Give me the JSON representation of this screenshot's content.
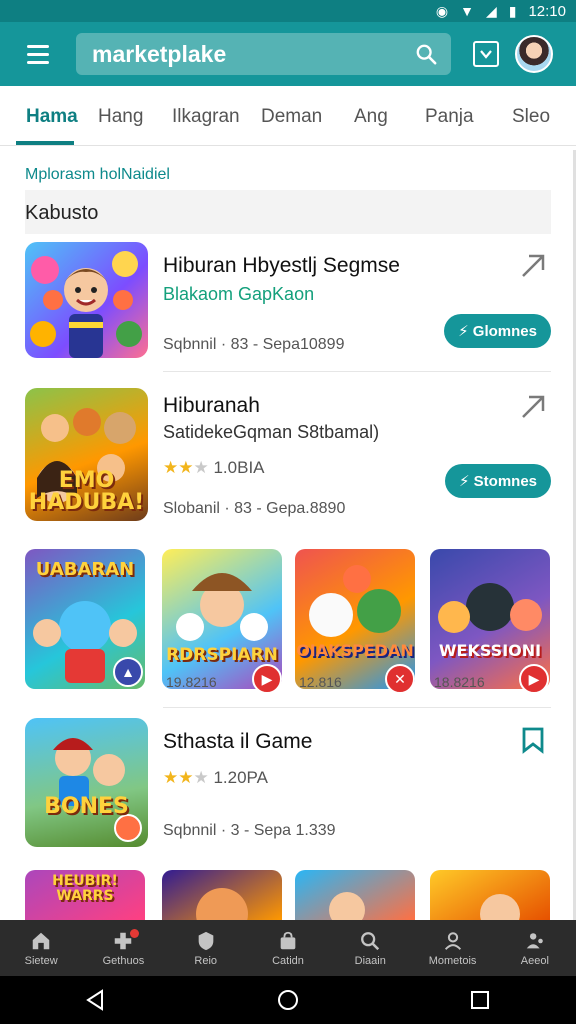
{
  "status_bar": {
    "time": "12:10",
    "icons": [
      "data-saver-icon",
      "wifi-icon",
      "signal-icon",
      "battery-icon"
    ]
  },
  "app_bar": {
    "search_text": "marketplake",
    "icons": [
      "menu-icon",
      "search-icon",
      "download-icon",
      "avatar"
    ]
  },
  "tabs": [
    {
      "label": "Hama",
      "active": true
    },
    {
      "label": "Hang"
    },
    {
      "label": "Ilkagran"
    },
    {
      "label": "Deman"
    },
    {
      "label": "Ang"
    },
    {
      "label": "Panja"
    },
    {
      "label": "Sleo"
    }
  ],
  "section": {
    "label": "Mplorasm holNaidiel",
    "header": "Kabusto"
  },
  "apps": [
    {
      "title": "Hiburan Hbyestlj Segmse",
      "subtitle": "Blakaom GapKaon",
      "meta": "Sqbnnil · 83 - Sepa10899",
      "action": "⚡ Glomnes",
      "pin_icon": "pin-icon"
    },
    {
      "title": "Hiburanah",
      "subtitle": "SatidekeGqman S8tbamal)",
      "rating": 2.5,
      "rating_text": "1.0BIA",
      "meta": "Slobanil · 83 - Gepa.8890",
      "action": "⚡ Stomnes",
      "pin_icon": "pin-icon"
    },
    {
      "title": "Sthasta il Game",
      "rating": 2.5,
      "rating_text": "1.20PA",
      "meta": "Sqbnnil · 3 - Sepa 1.339",
      "pin_icon": "bookmark-icon"
    }
  ],
  "grid": [
    {
      "art_text": "UABARAN",
      "label": ""
    },
    {
      "art_text": "RDRSPIARN",
      "label": "19.8216"
    },
    {
      "art_text": "OIAKSPEDAN",
      "label": "12.816"
    },
    {
      "art_text": "WEKSSIONI",
      "label": "18.8216"
    }
  ],
  "thumb_texts": {
    "app2": "EMO HADUBA!",
    "app3": "BONES",
    "row5a": "HEUBIR! WARRS"
  },
  "bottom_nav": [
    {
      "label": "Sietew",
      "icon": "home-icon"
    },
    {
      "label": "Gethuos",
      "icon": "games-icon",
      "dot": true
    },
    {
      "label": "Reio",
      "icon": "shield-icon"
    },
    {
      "label": "Catidn",
      "icon": "bag-icon"
    },
    {
      "label": "Diaain",
      "icon": "search-icon"
    },
    {
      "label": "Mometois",
      "icon": "person-icon"
    },
    {
      "label": "Aeeol",
      "icon": "account-icon"
    }
  ],
  "colors": {
    "primary": "#15969a",
    "primary_dark": "#0e7f82",
    "nav_bg": "#2c2c2c",
    "star": "#f2b51c"
  }
}
